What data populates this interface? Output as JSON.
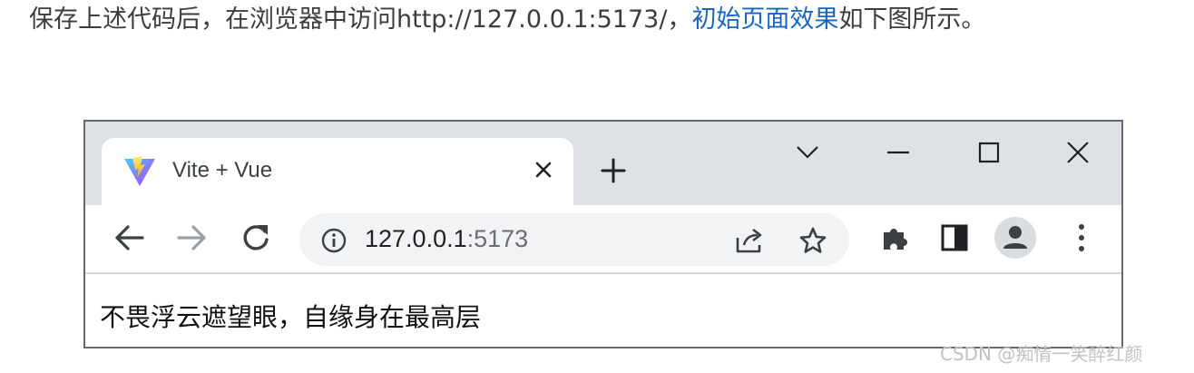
{
  "intro": {
    "text_before": "保存上述代码后，在浏览器中访问http://127.0.0.1:5173/，",
    "link_text": "初始页面效果",
    "text_after": "如下图所示。"
  },
  "browser": {
    "tab": {
      "title": "Vite + Vue",
      "logo_icon": "vite-logo-icon",
      "close_icon": "close-icon"
    },
    "new_tab_icon": "plus-icon",
    "window_controls": [
      "chevron-down-icon",
      "minimize-icon",
      "maximize-icon",
      "close-icon"
    ],
    "toolbar": {
      "back_icon": "arrow-left-icon",
      "forward_icon": "arrow-right-icon",
      "reload_icon": "reload-icon",
      "info_icon": "info-icon",
      "url_host": "127.0.0.1",
      "url_port": ":5173",
      "share_icon": "share-icon",
      "star_icon": "star-icon",
      "extensions_icon": "puzzle-icon",
      "side_panel_icon": "side-panel-icon",
      "profile_icon": "avatar-icon",
      "menu_icon": "kebab-menu-icon"
    },
    "page_text": "不畏浮云遮望眼，自缘身在最高层"
  },
  "watermark": "CSDN @痴情一笑醉红颜",
  "colors": {
    "link": "#1a66c0",
    "titlebar": "#dee1e6",
    "omnibox": "#f1f3f4",
    "icon": "#3c4043",
    "disabled_icon": "#9aa0a6"
  }
}
